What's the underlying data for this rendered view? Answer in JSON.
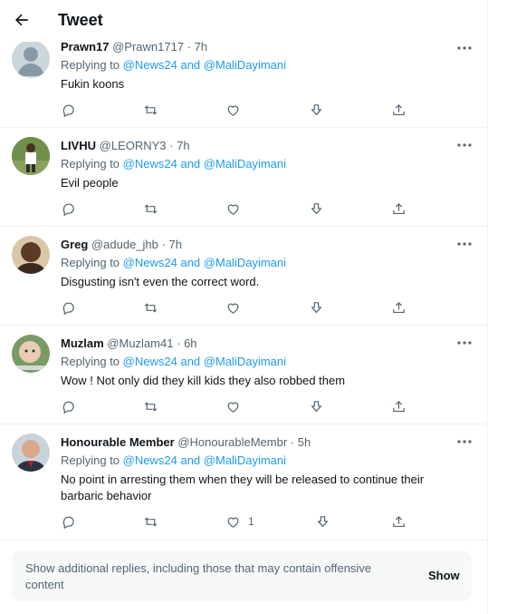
{
  "header": {
    "title": "Tweet"
  },
  "replying_label": "Replying to",
  "mentions": {
    "first": "@News24",
    "joiner": "and",
    "second": "@MaliDayimani"
  },
  "tweets": [
    {
      "name": "Prawn17",
      "handle": "@Prawn1717",
      "time": "7h",
      "text": "Fukin koons",
      "likes": ""
    },
    {
      "name": "LIVHU",
      "handle": "@LEORNY3",
      "time": "7h",
      "text": "Evil people",
      "likes": ""
    },
    {
      "name": "Greg",
      "handle": "@adude_jhb",
      "time": "7h",
      "text": "Disgusting isn't even the correct word.",
      "likes": ""
    },
    {
      "name": "Muzlam",
      "handle": "@Muzlam41",
      "time": "6h",
      "text": "Wow ! Not only did they kill kids they also robbed them",
      "likes": ""
    },
    {
      "name": "Honourable Member",
      "handle": "@HonourableMembr",
      "time": "5h",
      "text": "No point in arresting them when they will be released to continue their barbaric  behavior",
      "likes": "1"
    }
  ],
  "more_replies": {
    "text": "Show additional replies, including those that may contain offensive content",
    "button": "Show"
  },
  "colors": {
    "accent": "#1d9bf0",
    "secondary_text": "#536471",
    "divider": "#eff3f4"
  },
  "icons": [
    "back-arrow-icon",
    "more-icon",
    "reply-icon",
    "retweet-icon",
    "like-icon",
    "downvote-icon",
    "share-icon"
  ]
}
